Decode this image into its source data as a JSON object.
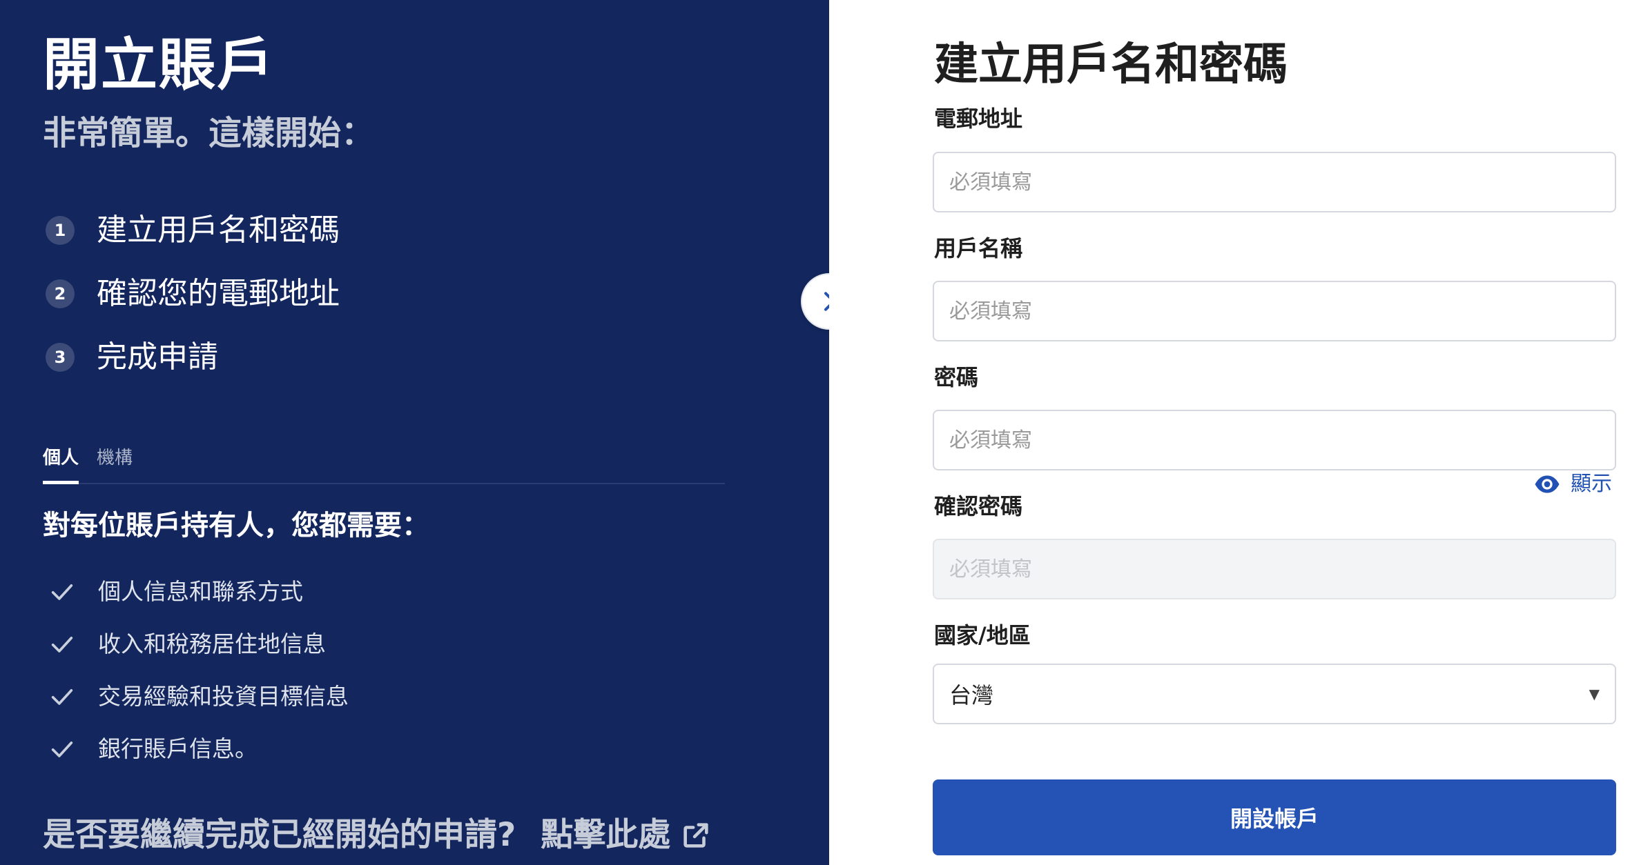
{
  "left": {
    "title": "開立賬戶",
    "subtitle": "非常簡單。這樣開始：",
    "steps": [
      {
        "num": "1",
        "label": "建立用戶名和密碼"
      },
      {
        "num": "2",
        "label": "確認您的電郵地址"
      },
      {
        "num": "3",
        "label": "完成申請"
      }
    ],
    "tabs": [
      {
        "label": "個人",
        "active": true
      },
      {
        "label": "機構",
        "active": false
      }
    ],
    "requirements_title": "對每位賬戶持有人，您都需要：",
    "requirements": [
      "個人信息和聯系方式",
      "收入和稅務居住地信息",
      "交易經驗和投資目標信息",
      "銀行賬戶信息。"
    ],
    "resume_text": "是否要繼續完成已經開始的申請?",
    "resume_link": "點擊此處"
  },
  "form": {
    "title": "建立用戶名和密碼",
    "email_label": "電郵地址",
    "email_placeholder": "必須填寫",
    "username_label": "用戶名稱",
    "username_placeholder": "必須填寫",
    "password_label": "密碼",
    "password_placeholder": "必須填寫",
    "show_label": "顯示",
    "confirm_label": "確認密碼",
    "confirm_placeholder": "必須填寫",
    "country_label": "國家/地區",
    "country_value": "台灣",
    "submit_label": "開設帳戶"
  },
  "colors": {
    "left_bg": "#13275e",
    "accent": "#2453b5",
    "link": "#2151b3"
  },
  "icons": {
    "nav": "chevron-right-icon",
    "check": "check-icon",
    "external": "external-link-icon",
    "eye": "eye-icon",
    "caret": "caret-down-icon"
  }
}
